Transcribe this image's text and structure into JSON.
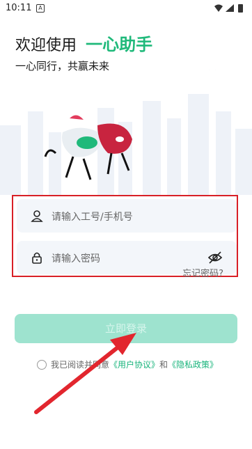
{
  "status": {
    "time": "10:11",
    "notif_icon": "A"
  },
  "header": {
    "welcome": "欢迎使用",
    "brand": "一心助手",
    "slogan": "一心同行，共赢未来"
  },
  "colors": {
    "brand": "#1fb97a",
    "accent_red": "#d81f26"
  },
  "form": {
    "username_placeholder": "请输入工号/手机号",
    "password_placeholder": "请输入密码",
    "forgot": "忘记密码?"
  },
  "login": {
    "label": "立即登录"
  },
  "agreement": {
    "prefix": "我已阅读并同意",
    "user_agreement": "《用户协议》",
    "and": "和",
    "privacy": "《隐私政策》"
  }
}
